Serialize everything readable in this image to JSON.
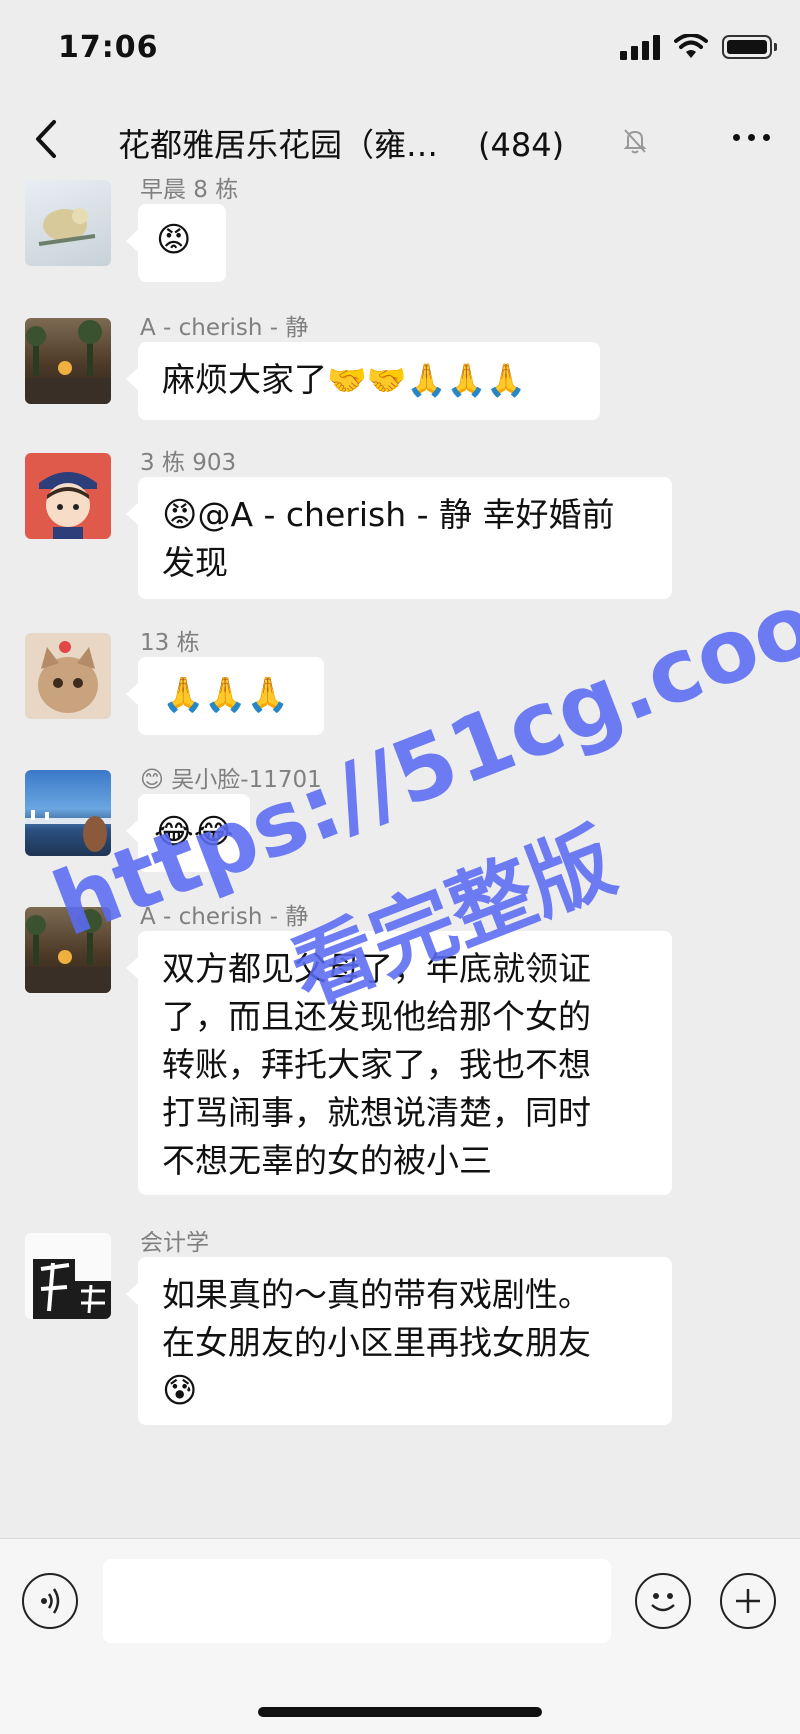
{
  "status_bar": {
    "time": "17:06"
  },
  "header": {
    "title": "花都雅居乐花园（雍…",
    "member_count": "(484)"
  },
  "messages": [
    {
      "sender": "早晨 8 栋",
      "text": "😡",
      "avatar_desc": "cartoon-avatar"
    },
    {
      "sender": "A - cherish - 静",
      "text": "麻烦大家了",
      "emojis": "🤝🤝🙏🙏🙏"
    },
    {
      "sender": "3 栋 903",
      "text_lines": [
        "@A - cherish - 静 幸好婚前",
        "发现"
      ],
      "emoji": "😡"
    },
    {
      "sender": "13 栋",
      "emojis": "🙏🙏🙏"
    },
    {
      "sender": "吴小脸-11701",
      "sender_emoji": "😊",
      "emojis": "😂😂"
    },
    {
      "sender": "A - cherish - 静",
      "text_lines": [
        "双方都见父母了，年底就领证",
        "了，而且还发现他给那个女的",
        "转账，拜托大家了，我也不想",
        "打骂闹事，就想说清楚，同时",
        "不想无辜的女的被小三"
      ]
    },
    {
      "sender": "会计学",
      "text_lines": [
        "如果真的～真的带有戏剧性。",
        "在女朋友的小区里再找女朋友"
      ],
      "emoji": "😰",
      "avatar_text": "唐朝"
    }
  ],
  "watermark": {
    "line1": "https://51cg.cool",
    "line2": "看完整版",
    "color": "#5b6cf2"
  },
  "input": {
    "placeholder": ""
  }
}
